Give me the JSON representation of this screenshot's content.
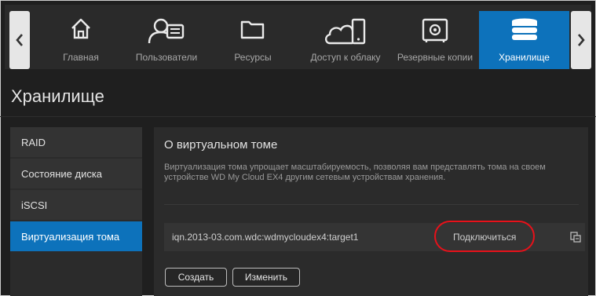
{
  "nav": {
    "prev_arrow": "chevron-left",
    "next_arrow": "chevron-right",
    "items": [
      {
        "label": "Главная",
        "icon": "home-icon"
      },
      {
        "label": "Пользователи",
        "icon": "users-icon"
      },
      {
        "label": "Ресурсы",
        "icon": "folder-icon"
      },
      {
        "label": "Доступ к облаку",
        "icon": "cloud-device-icon"
      },
      {
        "label": "Резервные копии",
        "icon": "safe-icon"
      },
      {
        "label": "Хранилище",
        "icon": "storage-icon",
        "active": true
      }
    ]
  },
  "page": {
    "title": "Хранилище"
  },
  "sidebar": {
    "items": [
      {
        "label": "RAID"
      },
      {
        "label": "Состояние диска"
      },
      {
        "label": "iSCSI"
      },
      {
        "label": "Виртуализация тома",
        "active": true
      }
    ]
  },
  "main": {
    "section_title": "О виртуальном томе",
    "description": "Виртуализация тома упрощает масштабируемость, позволяя вам представлять тома на своем устройстве WD My Cloud EX4 другим сетевым устройствам хранения.",
    "target": {
      "iqn": "iqn.2013-03.com.wdc:wdmycloudex4:target1",
      "connect_label": "Подключиться",
      "details_icon": "copy-details-icon"
    },
    "buttons": {
      "create": "Создать",
      "edit": "Изменить"
    }
  },
  "colors": {
    "accent": "#0d72bb",
    "highlight": "#e8111a",
    "background": "#1f1f1f"
  }
}
